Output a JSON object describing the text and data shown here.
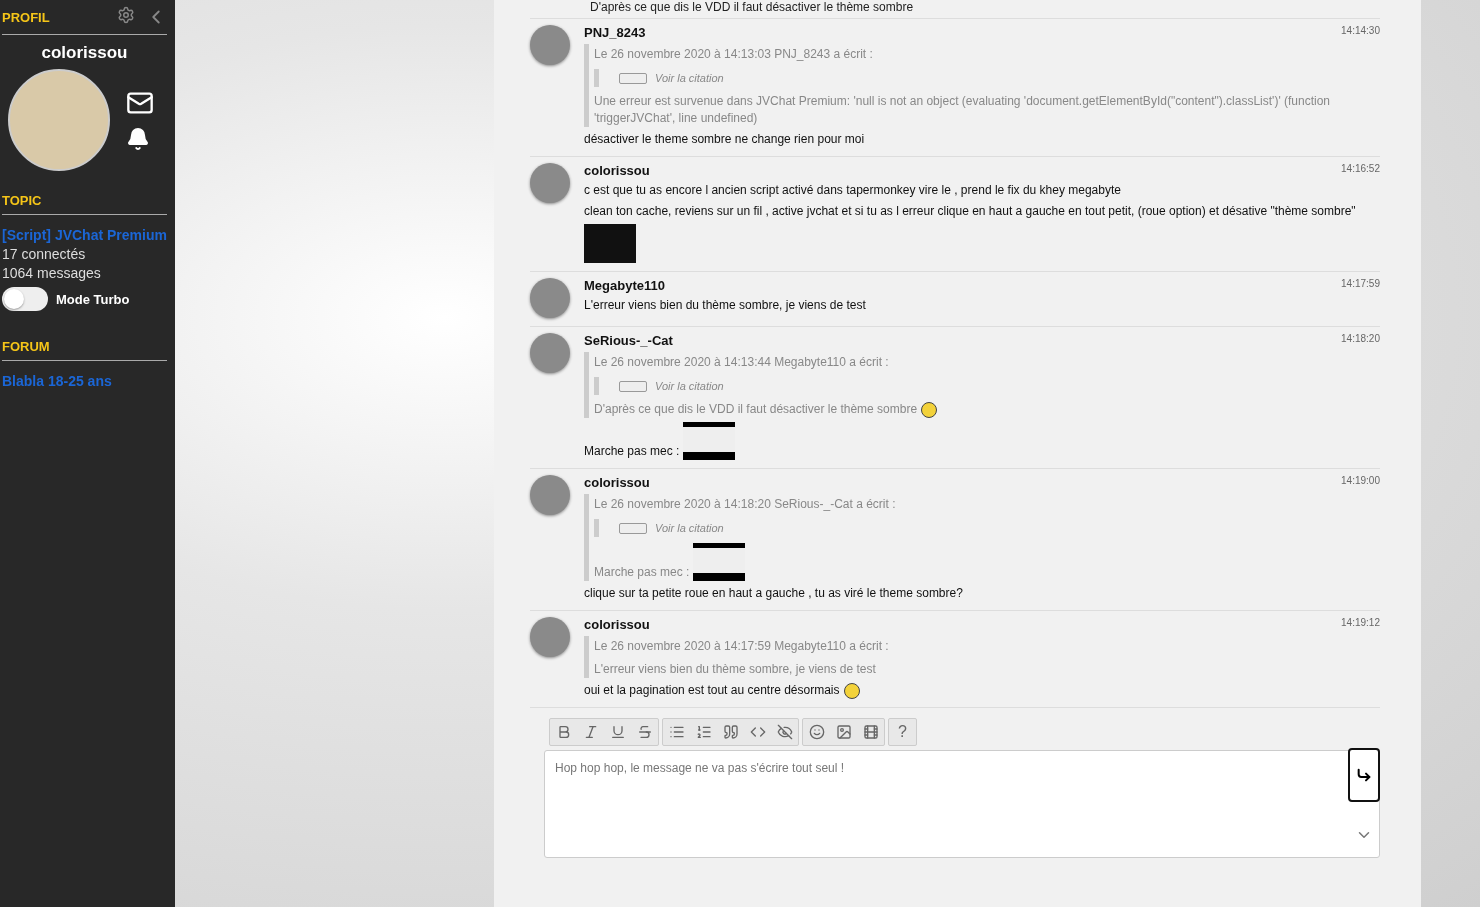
{
  "sidebar": {
    "profile": {
      "heading": "PROFIL",
      "username": "colorissou"
    },
    "topic": {
      "heading": "TOPIC",
      "title": "[Script] JVChat Premium",
      "connected": "17 connectés",
      "messages": "1064 messages",
      "turbo": {
        "label": "Mode Turbo",
        "on": false
      }
    },
    "forum": {
      "heading": "FORUM",
      "name": "Blabla 18-25 ans"
    }
  },
  "cut_line": "D'après ce que dis le VDD il faut désactiver le thème sombre",
  "messages": [
    {
      "author": "PNJ_8243",
      "time": "14:14:30",
      "blocks": [
        {
          "kind": "quote",
          "header": "Le 26 novembre 2020 à 14:13:03 PNJ_8243 a écrit :",
          "collapsed": "Voir la citation",
          "blocks": [
            {
              "kind": "text",
              "text": "Une erreur est survenue dans JVChat Premium: 'null is not an object (evaluating 'document.getElementById(\"content\").classList')' (function 'triggerJVChat', line undefined)"
            }
          ]
        },
        {
          "kind": "text",
          "text": "désactiver le theme sombre ne change rien pour moi"
        }
      ]
    },
    {
      "author": "colorissou",
      "time": "14:16:52",
      "blocks": [
        {
          "kind": "text",
          "text": "c est que tu as encore l ancien script activé dans tapermonkey vire le , prend le fix du khey megabyte"
        },
        {
          "kind": "text",
          "text": "clean ton cache, reviens sur un fil , active jvchat et si tu as l erreur clique en haut a gauche en tout petit, (roue option) et désative \"thème sombre\""
        },
        {
          "kind": "image"
        }
      ]
    },
    {
      "author": "Megabyte110",
      "time": "14:17:59",
      "blocks": [
        {
          "kind": "text",
          "text": "L'erreur viens bien du thème sombre, je viens de test"
        }
      ]
    },
    {
      "author": "SeRious-_-Cat",
      "time": "14:18:20",
      "blocks": [
        {
          "kind": "quote",
          "header": "Le 26 novembre 2020 à 14:13:44 Megabyte110 a écrit :",
          "collapsed": "Voir la citation",
          "blocks": [
            {
              "kind": "emoji_text",
              "text": "D'après ce que dis le VDD il faut désactiver le thème sombre"
            }
          ]
        },
        {
          "kind": "image_text",
          "text": "Marche pas mec :"
        }
      ]
    },
    {
      "author": "colorissou",
      "time": "14:19:00",
      "blocks": [
        {
          "kind": "quote",
          "header": "Le 26 novembre 2020 à 14:18:20 SeRious-_-Cat a écrit :",
          "collapsed": "Voir la citation",
          "blocks": [
            {
              "kind": "image_text",
              "text": "Marche pas mec :"
            }
          ]
        },
        {
          "kind": "text",
          "text": "clique sur ta petite roue en haut a gauche , tu as viré le theme sombre?"
        }
      ]
    },
    {
      "author": "colorissou",
      "time": "14:19:12",
      "blocks": [
        {
          "kind": "quote",
          "header": "Le 26 novembre 2020 à 14:17:59 Megabyte110 a écrit :",
          "blocks": [
            {
              "kind": "text",
              "text": "L'erreur viens bien du thème sombre, je viens de test"
            }
          ]
        },
        {
          "kind": "emoji_text",
          "text": "oui et la pagination est tout au centre désormais"
        }
      ]
    }
  ],
  "composer": {
    "help": "?",
    "placeholder": "Hop hop hop, le message ne va pas s'écrire tout seul !"
  }
}
